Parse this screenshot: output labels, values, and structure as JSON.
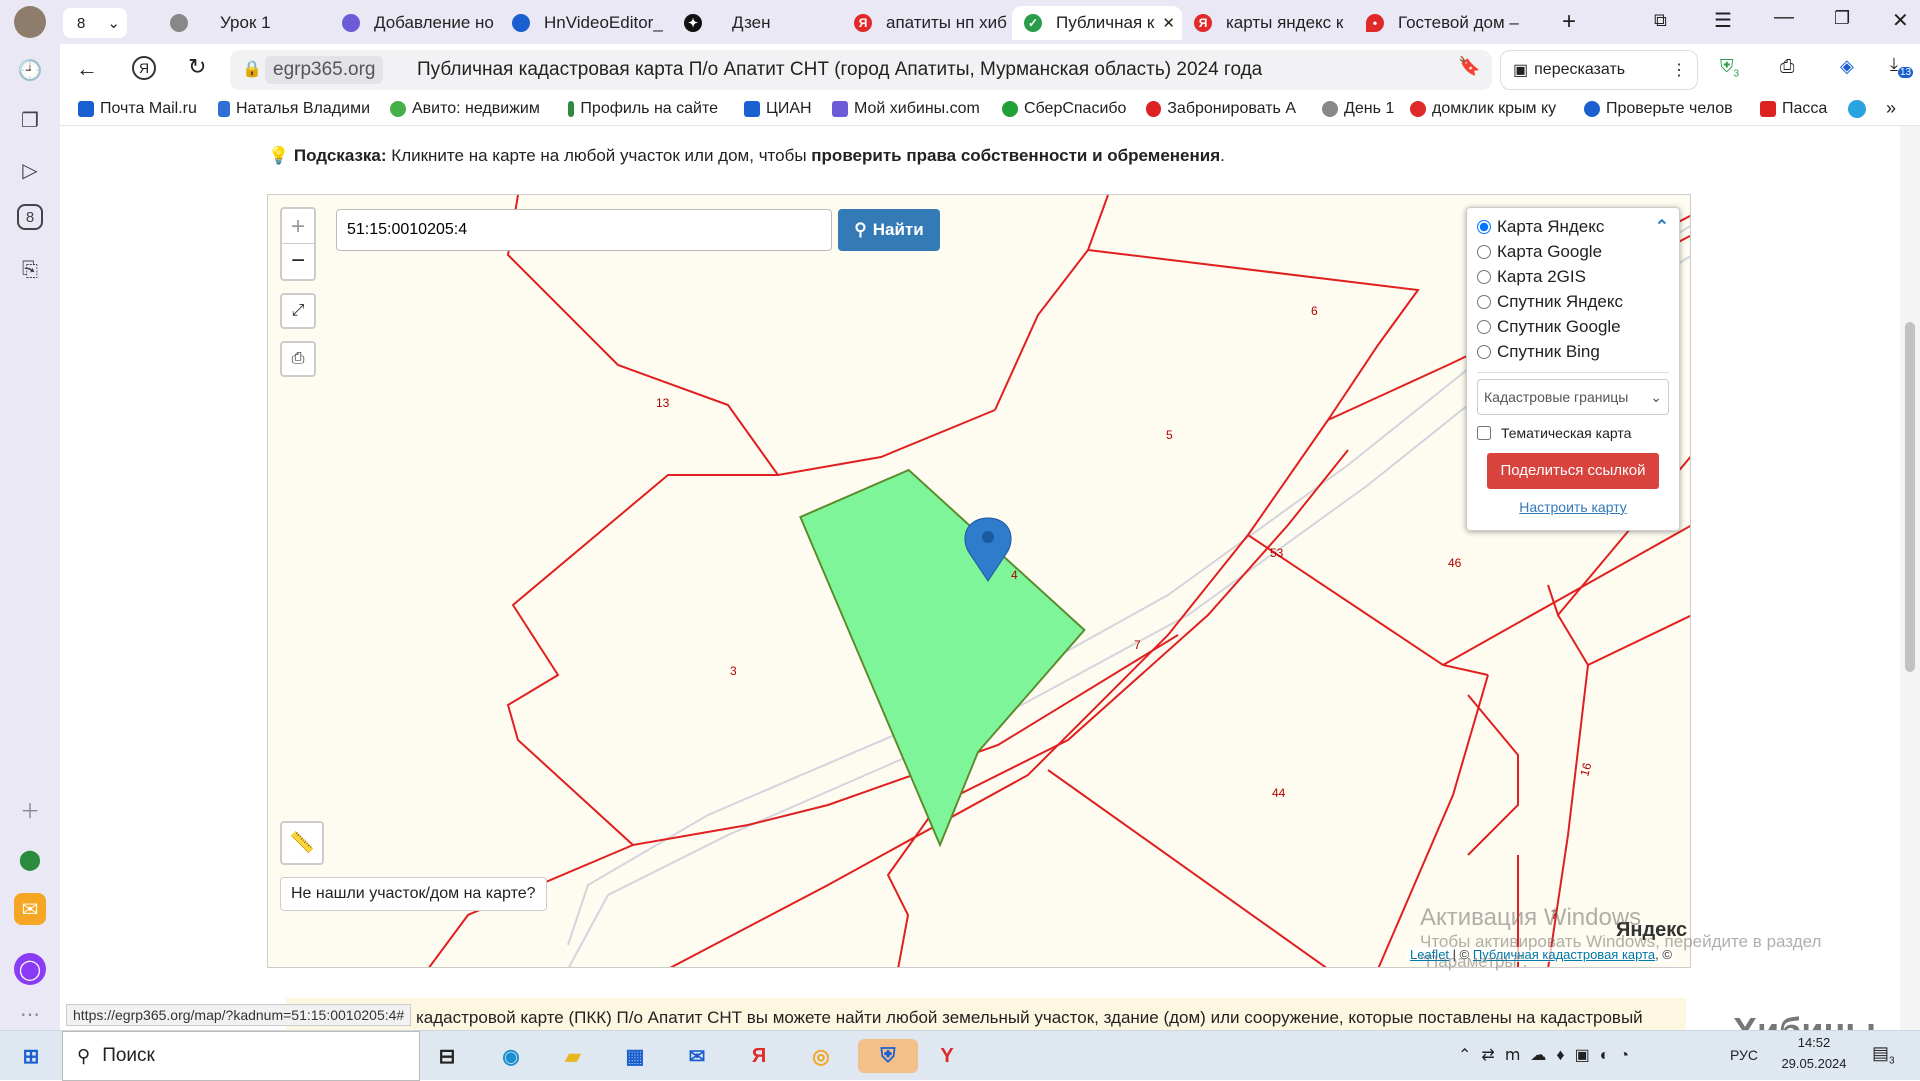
{
  "tabs": {
    "count": "8",
    "items": [
      {
        "label": "Урок 1"
      },
      {
        "label": "Добавление но"
      },
      {
        "label": "HnVideoEditor_"
      },
      {
        "label": "Дзен"
      },
      {
        "label": "апатиты нп хиб"
      },
      {
        "label": "Публичная к"
      },
      {
        "label": "карты яндекс к"
      },
      {
        "label": "Гостевой дом –"
      }
    ]
  },
  "address": {
    "domain": "egrp365.org",
    "title": "Публичная кадастровая карта П/о Апатит СНТ (город Апатиты, Мурманская область) 2024 года",
    "retell": "пересказать",
    "ext_badge": "13",
    "shield_badge": "3"
  },
  "bookmarks": [
    "Почта Mail.ru",
    "Наталья Владими",
    "Авито: недвижим",
    "Профиль на сайте",
    "ЦИАН",
    "Мой хибины.com",
    "СберСпасибо",
    "Забронировать А",
    "День 1",
    "домклик крым ку",
    "Проверьте челов",
    "Пасса"
  ],
  "hint": {
    "prefix": "Подсказка:",
    "text": " Кликните на карте на любой участок или дом, чтобы ",
    "bold": "проверить права собственности и обременения",
    "end": "."
  },
  "search": {
    "value": "51:15:0010205:4",
    "button": "Найти"
  },
  "layers": {
    "options": [
      "Карта Яндекс",
      "Карта Google",
      "Карта 2GIS",
      "Спутник Яндекс",
      "Спутник Google",
      "Спутник Bing"
    ],
    "selected": "Карта Яндекс",
    "select_value": "Кадастровые границы",
    "thematic": "Тематическая карта",
    "share": "Поделиться ссылкой",
    "configure": "Настроить карту"
  },
  "map": {
    "labels": [
      "6",
      "13",
      "5",
      "4",
      "53",
      "46",
      "3",
      "7",
      "44",
      "16",
      "7"
    ],
    "not_found": "Не нашли участок/дом на карте?",
    "yandex": "Яндекс",
    "attribution_leaflet": "Leaflet",
    "attribution_sep": " | © ",
    "attribution_pkk": "Публичная кадастровая карта",
    "attribution_end": ", ©"
  },
  "watermark": {
    "title": "Активация Windows",
    "text": "Чтобы активировать Windows, перейдите в раздел \"Параметры\"."
  },
  "status_url": "https://egrp365.org/map/?kadnum=51:15:0010205:4#",
  "bottom_text": "кадастровой карте (ПКК) П/о Апатит СНТ вы можете найти любой земельный участок, здание (дом) или сооружение, которые поставлены на кадастровый",
  "khibiny": "Хибины",
  "taskbar": {
    "search": "Поиск",
    "lang": "РУС",
    "time": "14:52",
    "date": "29.05.2024",
    "notif": "3"
  },
  "colors": {
    "parcel_selected": "#7ff59a",
    "border": "#e02020",
    "road": "#d6d6dc",
    "map_bg": "#fefcf0",
    "button_blue": "#337ab7",
    "share_red": "#d9433d"
  }
}
